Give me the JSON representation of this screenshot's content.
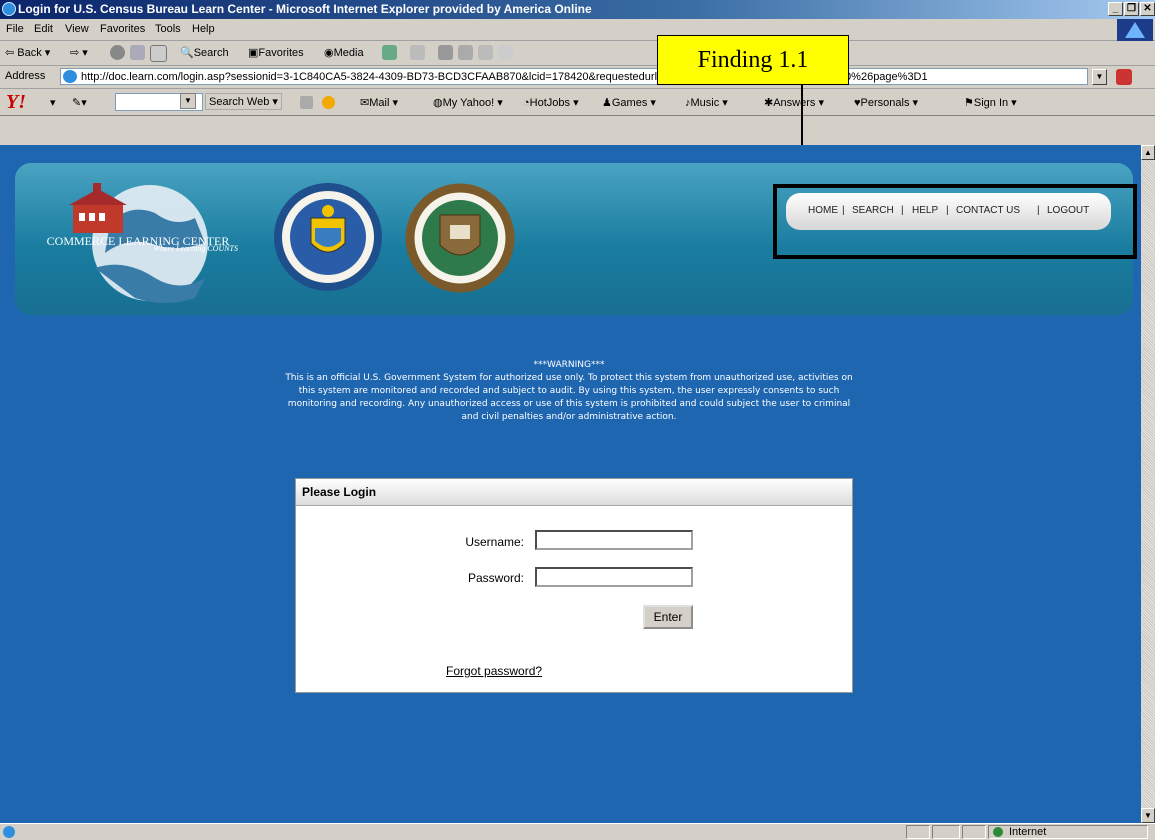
{
  "window": {
    "title": "Login for U.S. Census Bureau Learn Center - Microsoft Internet Explorer provided by America Online",
    "controls": [
      "_",
      "❐",
      "✕"
    ]
  },
  "menu": [
    "File",
    "Edit",
    "View",
    "Favorites",
    "Tools",
    "Help"
  ],
  "toolbar": {
    "back": "Back",
    "search": "Search",
    "favorites": "Favorites",
    "media": "Media"
  },
  "address": {
    "label": "Address",
    "url": "http://doc.learn.com/login.asp?sessionid=3-1C840CA5-3824-4309-BD73-BCD3CFAAB870&lcid=178420&requestedurl=learncenter%2Easp%3Fid%3D178420%26page%3D1"
  },
  "yahoo_bar": {
    "search_web": "Search Web",
    "items": [
      "Mail",
      "My Yahoo!",
      "HotJobs",
      "Games",
      "Music",
      "Answers",
      "Personals",
      "Sign In"
    ]
  },
  "callout": {
    "label": "Finding 1.1"
  },
  "header": {
    "logo_title": "COMMERCE LEARNING CENTER",
    "logo_tagline": "Where Learning COUNTS",
    "nav": [
      "HOME",
      "SEARCH",
      "HELP",
      "CONTACT US",
      "LOGOUT"
    ]
  },
  "warning": {
    "title": "***WARNING***",
    "body": "This is an official U.S. Government System for authorized use only. To protect this system from unauthorized use, activities on this system are monitored and recorded and subject to audit. By using this system, the user expressly consents to such monitoring and recording. Any unauthorized access or use of this system is prohibited and could subject the user to criminal and civil penalties and/or administrative action."
  },
  "login": {
    "heading": "Please Login",
    "username_label": "Username:",
    "username_value": "",
    "password_label": "Password:",
    "password_value": "",
    "enter_label": "Enter",
    "forgot_label": "Forgot password?"
  },
  "status": {
    "zone": "Internet"
  },
  "colors": {
    "page_bg": "#1f66b1",
    "header_panel": "#1a7da0",
    "callout": "#ffff00"
  }
}
